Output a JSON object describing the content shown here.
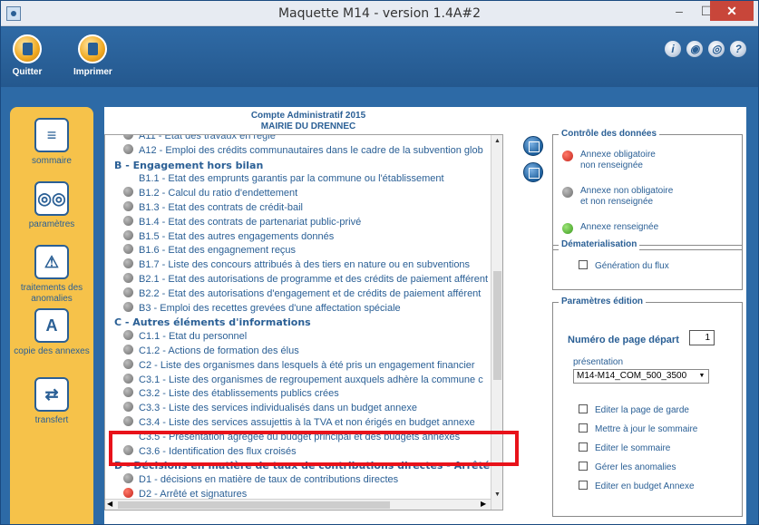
{
  "window": {
    "title": "Maquette M14 - version 1.4A#2",
    "controls": {
      "minimize": "–",
      "maximize": "☐",
      "close": "✕"
    }
  },
  "toolbar": {
    "quit_label": "Quitter",
    "print_label": "Imprimer",
    "help_icons": [
      "i",
      "◉",
      "◎",
      "?"
    ]
  },
  "sidebar": {
    "items": [
      {
        "label": "sommaire",
        "icon": "≡"
      },
      {
        "label": "paramètres",
        "icon": "◎◎"
      },
      {
        "label": "traitements des anomalies",
        "icon": "⚠"
      },
      {
        "label": "copie des annexes",
        "icon": "A"
      },
      {
        "label": "transfert",
        "icon": "⇄"
      }
    ]
  },
  "report": {
    "title": "Compte Administratif 2015",
    "subtitle": "MAIRIE DU DRENNEC"
  },
  "list": {
    "rows": [
      {
        "type": "item",
        "text": "A11 - Etat des travaux en régie"
      },
      {
        "type": "item",
        "text": "A12 - Emploi des crédits communautaires dans le cadre de la subvention glob"
      },
      {
        "type": "section",
        "text": "B - Engagement hors bilan"
      },
      {
        "type": "plain",
        "text": "B1.1 - Etat des emprunts garantis par la commune ou l'établissement"
      },
      {
        "type": "item",
        "text": "B1.2 - Calcul du ratio d'endettement"
      },
      {
        "type": "item",
        "text": "B1.3 - Etat des contrats de crédit-bail"
      },
      {
        "type": "item",
        "text": "B1.4 - Etat des contrats de partenariat public-privé"
      },
      {
        "type": "item",
        "text": "B1.5 - Etat des autres engagements donnés"
      },
      {
        "type": "item",
        "text": "B1.6 - Etat des engagnement reçus"
      },
      {
        "type": "item",
        "text": "B1.7 - Liste des concours attribués à des tiers en nature ou en subventions"
      },
      {
        "type": "item",
        "text": "B2.1 - Etat des autorisations de programme et des crédits de paiement afférent"
      },
      {
        "type": "item",
        "text": "B2.2 - Etat des autorisations d'engagement et de crédits de paiement afférent"
      },
      {
        "type": "item",
        "text": "B3 - Emploi des recettes grevées d'une affectation spéciale"
      },
      {
        "type": "section",
        "text": "C - Autres éléments d'informations"
      },
      {
        "type": "item",
        "text": "C1.1 - Etat du personnel"
      },
      {
        "type": "item",
        "text": "C1.2 - Actions de formation des élus"
      },
      {
        "type": "item",
        "text": "C2 - Liste des organismes dans lesquels à été pris un engagement financier"
      },
      {
        "type": "item",
        "text": "C3.1 - Liste des organismes de regroupement auxquels adhère la commune c"
      },
      {
        "type": "item",
        "text": "C3.2 - Liste des établissements publics crées"
      },
      {
        "type": "item",
        "text": "C3.3 - Liste des services individualisés dans un budget annexe"
      },
      {
        "type": "item",
        "text": "C3.4 - Liste des services assujettis à la TVA et non érigés en budget annexe"
      },
      {
        "type": "plain",
        "text": "C3.5 - Présentation agrégée du budget principal et des budgets annexes"
      },
      {
        "type": "item",
        "text": "C3.6 - Identification des flux croisés"
      },
      {
        "type": "section",
        "text": "D - Décisions en matière de taux de contributions directes - Arrêté et s"
      },
      {
        "type": "item",
        "text": "D1 - décisions en matière de taux de contributions directes"
      },
      {
        "type": "error",
        "text": "D2 - Arrêté et signatures"
      }
    ]
  },
  "controle": {
    "title": "Contrôle des données",
    "legend": [
      {
        "color": "red",
        "line1": "Annexe obligatoire",
        "line2": "non renseignée"
      },
      {
        "color": "gray",
        "line1": "Annexe non obligatoire",
        "line2": "et non renseignée"
      },
      {
        "color": "green",
        "line1": "Annexe renseignée",
        "line2": ""
      }
    ]
  },
  "dematerialisation": {
    "title": "Dématerialisation",
    "option": "Génération du flux"
  },
  "parametres": {
    "title": "Paramètres édition",
    "page_label": "Numéro de page départ",
    "page_value": "1",
    "presentation_label": "présentation",
    "presentation_value": "M14-M14_COM_500_3500",
    "options": [
      "Editer la page de garde",
      "Mettre à jour le sommaire",
      "Editer le sommaire",
      "Gérer les anomalies",
      "Editer en budget Annexe"
    ]
  }
}
